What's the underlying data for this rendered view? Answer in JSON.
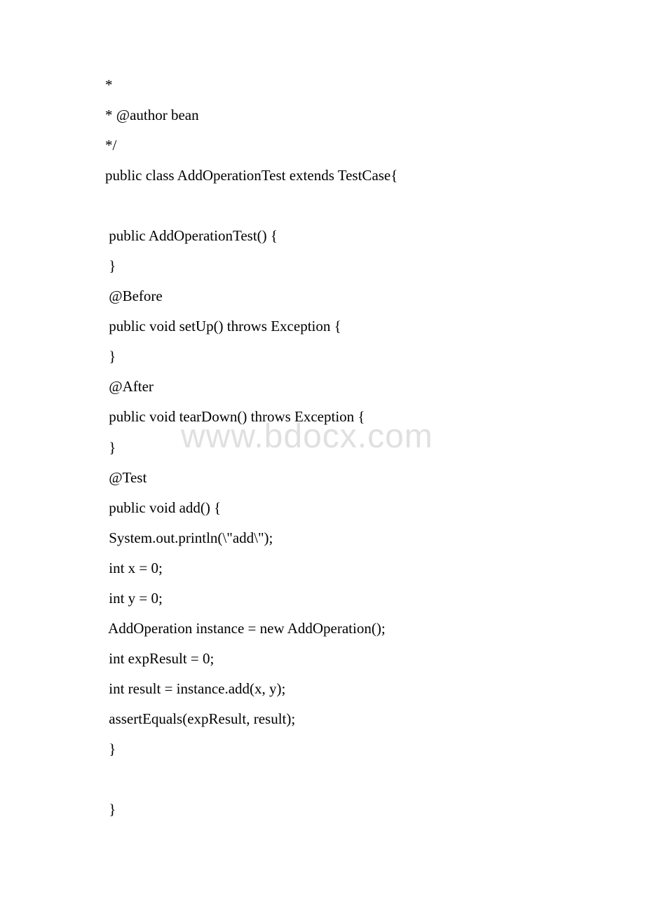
{
  "watermark": "www.bdocx.com",
  "code": {
    "line1": "*",
    "line2": "* @author bean",
    "line3": "*/",
    "line4": "public class AddOperationTest extends TestCase{",
    "line5": " public AddOperationTest() {",
    "line6": " }",
    "line7": " @Before",
    "line8": " public void setUp() throws Exception {",
    "line9": " }",
    "line10": " @After",
    "line11": " public void tearDown() throws Exception {",
    "line12": " }",
    "line13": " @Test",
    "line14": " public void add() {",
    "line15": " System.out.println(\\\"add\\\");",
    "line16": " int x = 0;",
    "line17": " int y = 0;",
    "line18": " AddOperation instance = new AddOperation();",
    "line19": " int expResult = 0;",
    "line20": " int result = instance.add(x, y);",
    "line21": " assertEquals(expResult, result);",
    "line22": " }",
    "line23": " }"
  }
}
